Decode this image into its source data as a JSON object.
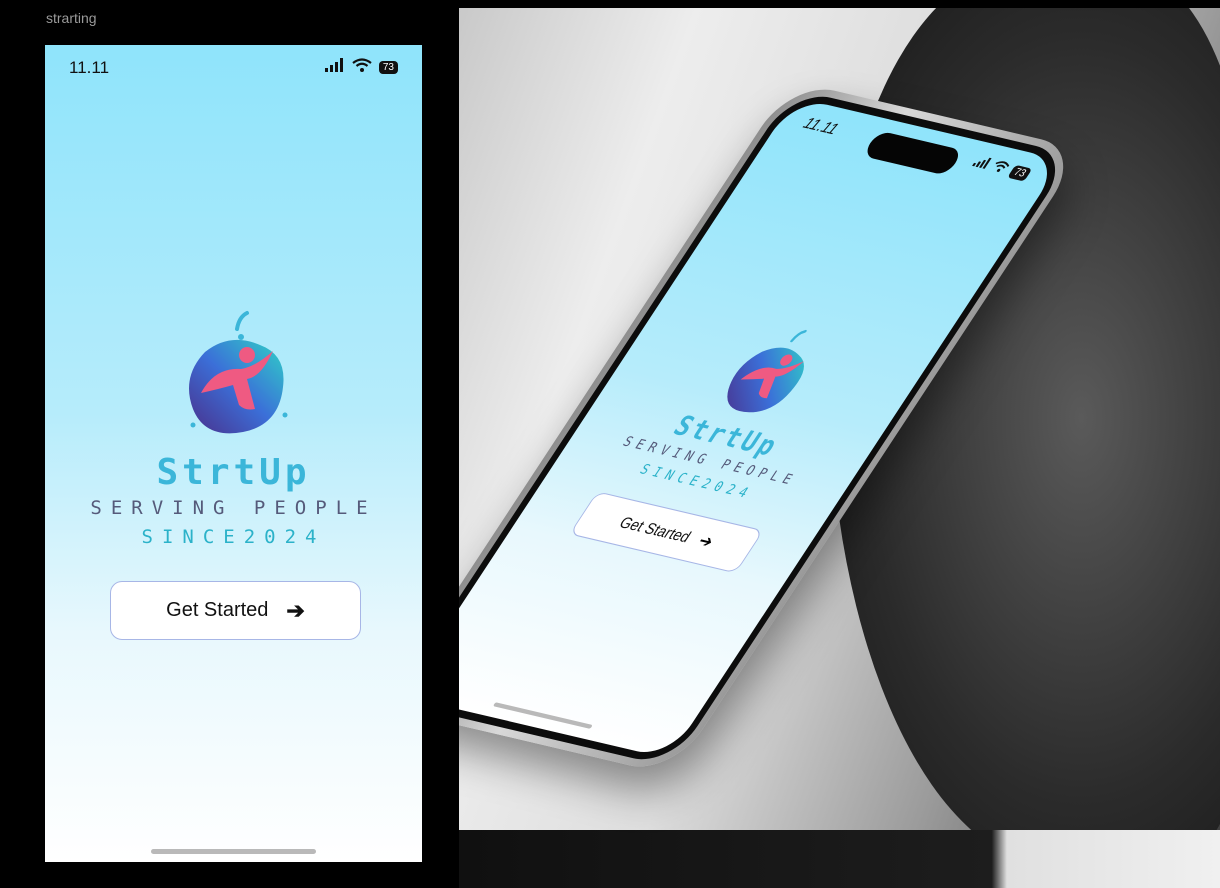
{
  "frame": {
    "label": "strarting"
  },
  "status_bar": {
    "time": "11.11",
    "battery": "73"
  },
  "brand": {
    "name": "StrtUp",
    "tagline": "SERVING PEOPLE",
    "since": "SINCE2024"
  },
  "cta": {
    "label": "Get Started",
    "arrow": "➔"
  },
  "colors": {
    "gradient_top": "#8fe4fb",
    "gradient_bottom": "#ffffff",
    "title": "#3bb6d9",
    "tagline": "#555a7a",
    "since": "#2bb2c9",
    "button_border": "#a7b6e6"
  },
  "icons": [
    "cellular-signal-icon",
    "wifi-icon",
    "battery-icon",
    "arrow-right-icon",
    "startup-logo"
  ]
}
